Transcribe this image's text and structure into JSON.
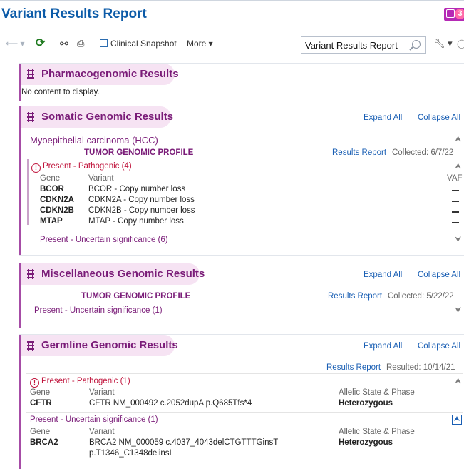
{
  "window": {
    "title": "Variant Results Report",
    "badge_count": "3",
    "accent": "#a64ca6",
    "title_color": "#0c5ba8"
  },
  "toolbar": {
    "back_icon": "back-arrow-icon",
    "refresh_icon": "refresh-icon",
    "find_icon": "binoculars-icon",
    "print_icon": "print-icon",
    "snapshot_icon": "snapshot-icon",
    "clinical_snapshot": "Clinical Snapshot",
    "more": "More ▾",
    "search_value": "Variant Results Report",
    "tools_icon": "wrench-icon"
  },
  "pharmacogenomic": {
    "title": "Pharmacogenomic Results",
    "empty": "No content to display."
  },
  "somatic": {
    "title": "Somatic Genomic Results",
    "expand_all": "Expand All",
    "collapse_all": "Collapse All",
    "diagnosis": "Myoepithelial carcinoma (HCC)",
    "profile": "TUMOR GENOMIC PROFILE",
    "results_report": "Results Report",
    "collected": "Collected: 6/7/22",
    "pathogenic_label": "Present - Pathogenic (4)",
    "col_gene": "Gene",
    "col_variant": "Variant",
    "col_vaf": "VAF",
    "rows": [
      {
        "gene": "BCOR",
        "variant": "BCOR - Copy number loss"
      },
      {
        "gene": "CDKN2A",
        "variant": "CDKN2A - Copy number loss"
      },
      {
        "gene": "CDKN2B",
        "variant": "CDKN2B - Copy number loss"
      },
      {
        "gene": "MTAP",
        "variant": "MTAP - Copy number loss"
      }
    ],
    "uncertain_label": "Present - Uncertain significance (6)"
  },
  "misc": {
    "title": "Miscellaneous Genomic Results",
    "expand_all": "Expand All",
    "collapse_all": "Collapse All",
    "profile": "TUMOR GENOMIC PROFILE",
    "results_report": "Results Report",
    "collected": "Collected: 5/22/22",
    "uncertain_label": "Present - Uncertain significance (1)"
  },
  "germline": {
    "title": "Germline Genomic Results",
    "expand_all": "Expand All",
    "collapse_all": "Collapse All",
    "results_report": "Results Report",
    "resulted": "Resulted: 10/14/21",
    "pathogenic_label": "Present - Pathogenic (1)",
    "col_gene": "Gene",
    "col_variant": "Variant",
    "col_state": "Allelic State & Phase",
    "pathogenic_rows": [
      {
        "gene": "CFTR",
        "variant": "CFTR NM_000492 c.2052dupA p.Q685Tfs*4",
        "state": "Heterozygous"
      }
    ],
    "uncertain_label": "Present - Uncertain significance (1)",
    "uncertain_rows": [
      {
        "gene": "BRCA2",
        "variant_line1": "BRCA2 NM_000059 c.4037_4043delCTGTTTGinsT",
        "variant_line2": "p.T1346_C1348delinsI",
        "state": "Heterozygous"
      }
    ]
  }
}
